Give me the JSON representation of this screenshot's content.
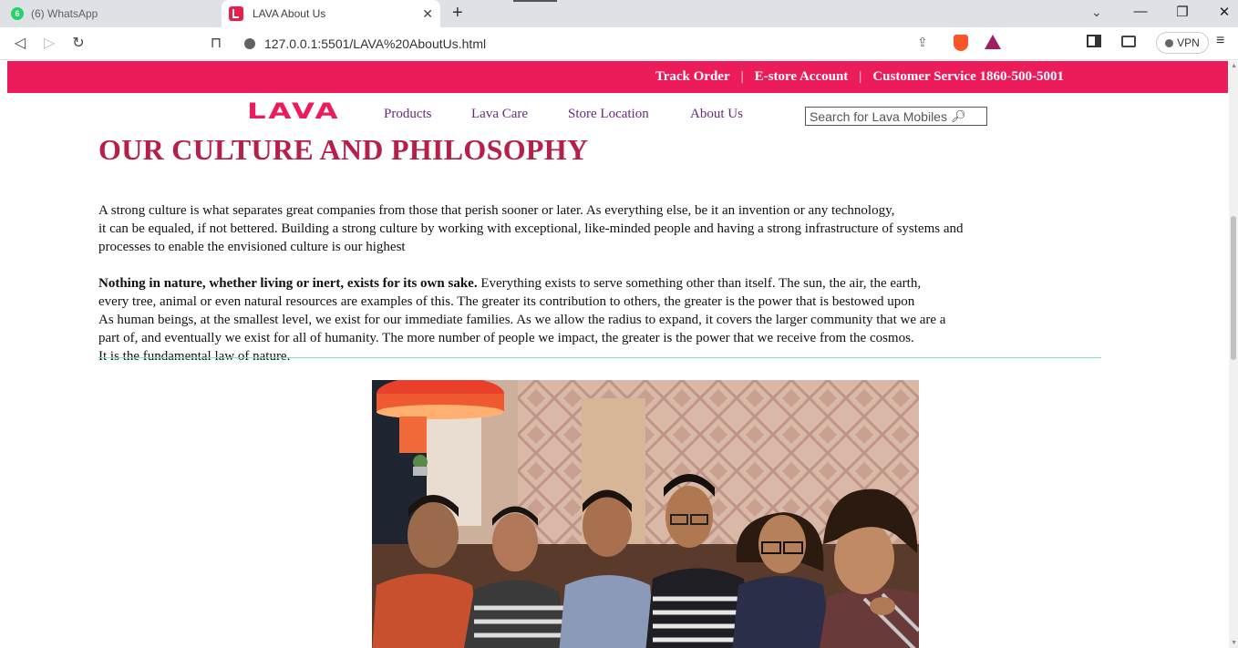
{
  "browser": {
    "tabs": [
      {
        "title": "(6) WhatsApp",
        "badge": "6",
        "active": false
      },
      {
        "title": "LAVA About Us",
        "active": true
      }
    ],
    "url": "127.0.0.1:5501/LAVA%20AboutUs.html",
    "vpn_label": "VPN",
    "icons": [
      "back-icon",
      "forward-icon",
      "reload-icon",
      "bookmark-icon",
      "share-icon",
      "brave-shields-icon",
      "brave-rewards-icon",
      "sidebar-icon",
      "wallet-icon",
      "menu-icon"
    ]
  },
  "topbar": {
    "track_order": "Track Order",
    "estore": "E-store Account",
    "customer_service": "Customer Service 1860-500-5001",
    "separator": "|"
  },
  "header": {
    "logo": "LAVA",
    "nav": [
      "Products",
      "Lava Care",
      "Store Location",
      "About Us"
    ],
    "search_placeholder": "Search for Lava Mobiles"
  },
  "main": {
    "heading": "OUR CULTURE AND PHILOSOPHY",
    "para1": [
      "A strong culture is what separates great companies from those that perish sooner or later. As everything else, be it an invention or any technology,",
      "it can be equaled, if not bettered. Building a strong culture by working with exceptional, like-minded people and having a strong infrastructure of systems and",
      "processes to enable the envisioned culture is our highest"
    ],
    "para2_bold": "Nothing in nature, whether living or inert, exists for its own sake.",
    "para2_first_rest": " Everything exists to serve something other than itself. The sun, the air, the earth,",
    "para2": [
      "every tree, animal or even natural resources are examples of this. The greater its contribution to others, the greater is the power that is bestowed upon",
      "As human beings, at the smallest level, we exist for our immediate families. As we allow the radius to expand, it covers the larger community that we are a",
      "part of, and eventually we exist for all of humanity. The more number of people we impact, the greater is the power that we receive from the cosmos.",
      "It is the fundamental law of nature."
    ]
  },
  "colors": {
    "brand": "#ec1b5a",
    "heading": "#b51f48",
    "nav": "#6a2a7a"
  }
}
